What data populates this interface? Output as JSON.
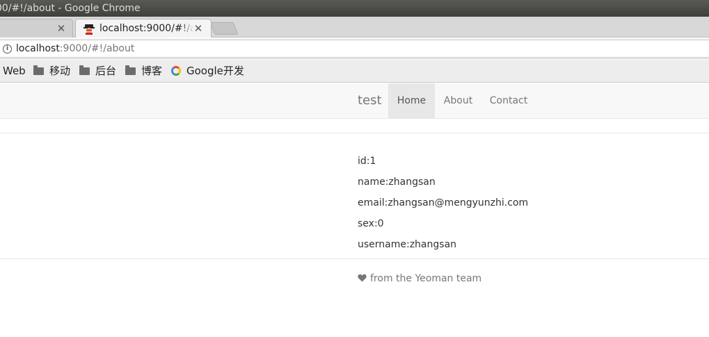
{
  "window": {
    "title": "00/#!/about - Google Chrome"
  },
  "tabs": [
    {
      "title": "",
      "active": false
    },
    {
      "title": "localhost:9000/#!/about",
      "active": true
    }
  ],
  "address": {
    "host": "localhost",
    "path": ":9000/#!/about"
  },
  "bookmarks": [
    {
      "label": "Web",
      "icon": "none"
    },
    {
      "label": "移动",
      "icon": "folder-icon"
    },
    {
      "label": "后台",
      "icon": "folder-icon"
    },
    {
      "label": "博客",
      "icon": "folder-icon"
    },
    {
      "label": "Google开发",
      "icon": "google-icon"
    }
  ],
  "navbar": {
    "brand": "test",
    "links": [
      {
        "label": "Home",
        "active": true
      },
      {
        "label": "About",
        "active": false
      },
      {
        "label": "Contact",
        "active": false
      }
    ]
  },
  "user": {
    "lines": [
      "id:1",
      "name:zhangsan",
      "email:zhangsan@mengyunzhi.com",
      "sex:0",
      "username:zhangsan"
    ]
  },
  "footer": {
    "text": "from the Yeoman team",
    "icon": "heart-icon"
  },
  "colors": {
    "navbar_bg": "#f8f8f8",
    "active_link_bg": "#e7e7e7",
    "muted_text": "#777777"
  }
}
